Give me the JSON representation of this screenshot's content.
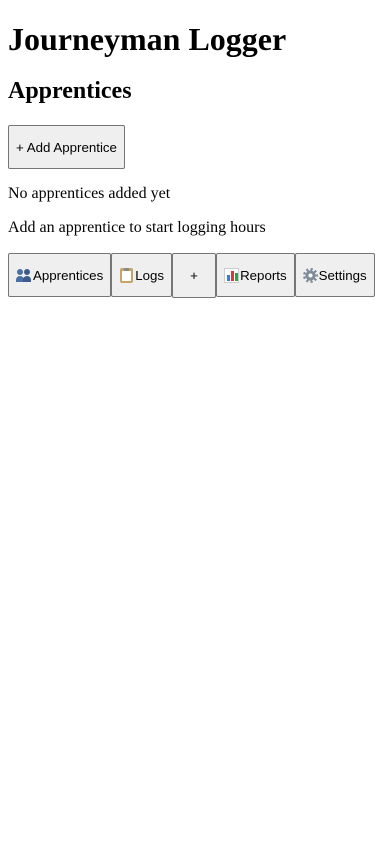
{
  "app": {
    "title": "Journeyman Logger"
  },
  "section": {
    "title": "Apprentices",
    "add_button_label": "+ Add Apprentice"
  },
  "empty_state": {
    "message": "No apprentices added yet",
    "hint": "Add an apprentice to start logging hours"
  },
  "nav": {
    "items": [
      {
        "label": "Apprentices",
        "icon": "people-icon"
      },
      {
        "label": "Logs",
        "icon": "clipboard-icon"
      },
      {
        "label": "+",
        "icon": ""
      },
      {
        "label": "Reports",
        "icon": "bar-chart-icon"
      },
      {
        "label": "Settings",
        "icon": "gear-icon"
      }
    ]
  }
}
